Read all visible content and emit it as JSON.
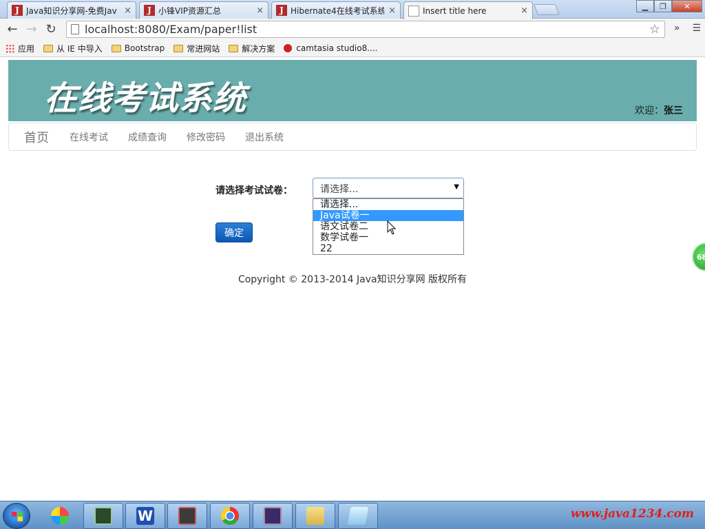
{
  "browser": {
    "tabs": [
      {
        "title": "Java知识分享网-免费Jav",
        "icon": "java1234-favicon",
        "active": false
      },
      {
        "title": "小锋VIP资源汇总",
        "icon": "java1234-favicon",
        "active": false
      },
      {
        "title": "Hibernate4在线考试系统",
        "icon": "java1234-favicon",
        "active": false
      },
      {
        "title": "Insert title here",
        "icon": "page-icon",
        "active": true
      }
    ],
    "tab_close_glyph": "×",
    "url": "localhost:8080/Exam/paper!list",
    "bookmarks": [
      {
        "label": "应用",
        "icon": "apps-icon"
      },
      {
        "label": "从 IE 中导入",
        "icon": "folder-icon"
      },
      {
        "label": "Bootstrap",
        "icon": "folder-icon"
      },
      {
        "label": "常进网站",
        "icon": "folder-icon"
      },
      {
        "label": "解决方案",
        "icon": "folder-icon"
      },
      {
        "label": "camtasia studio8....",
        "icon": "camtasia-icon"
      }
    ],
    "overflow_label": "»"
  },
  "header": {
    "logo_text": "在线考试系统",
    "welcome_prefix": "欢迎：",
    "username": "张三",
    "bg_color": "#6aadad"
  },
  "nav": {
    "brand": "首页",
    "links": [
      "在线考试",
      "成绩查询",
      "修改密码",
      "退出系统"
    ]
  },
  "form": {
    "label": "请选择考试试卷：",
    "select_value": "请选择...",
    "options": [
      "请选择...",
      "Java试卷一",
      "语文试卷二",
      "数学试卷一",
      "22"
    ],
    "highlighted_option": "Java试卷一",
    "submit_label": "确定"
  },
  "footer": {
    "copyright": "Copyright © 2013-2014 Java知识分享网 版权所有"
  },
  "side_badge": "68",
  "taskbar": {
    "items": [
      "terminal-icon",
      "wps-writer-icon",
      "media-icon",
      "chrome-icon",
      "javaee-ide-icon",
      "explorer-icon",
      "notepad-icon"
    ],
    "watermark": "www.java1234.com"
  }
}
